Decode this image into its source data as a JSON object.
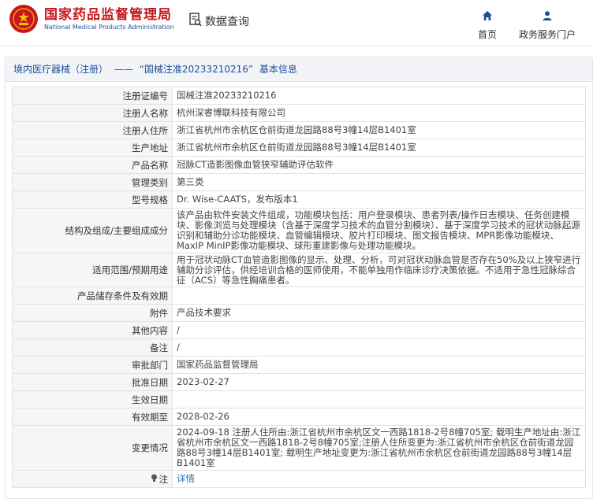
{
  "header": {
    "brand_cn": "国家药品监督管理局",
    "brand_en": "National Medical Products Administration",
    "search_label": "数据查询",
    "nav": [
      {
        "label": "首页",
        "icon": "home-icon"
      },
      {
        "label": "政务服务门户",
        "icon": "user-icon"
      }
    ]
  },
  "breadcrumb": {
    "category": "境内医疗器械（注册）",
    "sep": "——",
    "record": "“国械注准20233210216”",
    "suffix": "基本信息"
  },
  "rows": [
    {
      "key": "注册证编号",
      "value": "国械注准20233210216"
    },
    {
      "key": "注册人名称",
      "value": "杭州深睿博联科技有限公司"
    },
    {
      "key": "注册人住所",
      "value": "浙江省杭州市余杭区仓前街道龙园路88号3幢14层B1401室"
    },
    {
      "key": "生产地址",
      "value": "浙江省杭州市余杭区仓前街道龙园路88号3幢14层B1401室"
    },
    {
      "key": "产品名称",
      "value": "冠脉CT造影图像血管狭窄辅助评估软件"
    },
    {
      "key": "管理类别",
      "value": "第三类"
    },
    {
      "key": "型号规格",
      "value": "Dr. Wise-CAATS，发布版本1"
    },
    {
      "key": "结构及组成/主要组成成分",
      "value": "该产品由软件安装文件组成，功能模块包括：用户登录模块、患者列表/操作日志模块、任务创建模块、影像浏览与处理模块（含基于深度学习技术的血管分割模块）、基于深度学习技术的冠状动脉起源识别和辅助分诊功能模块、血管编辑模块、胶片打印模块、图文报告模块、MPR影像功能模块、MaxIP MinIP影像功能模块、球形重建影像与处理功能模块。"
    },
    {
      "key": "适用范围/预期用途",
      "value": "用于冠状动脉CT血管造影图像的显示、处理、分析，可对冠状动脉血管是否存在50%及以上狭窄进行辅助分诊评估，供经培训合格的医师使用，不能单独用作临床诊疗决策依据。不适用于急性冠脉综合征（ACS）等急性胸痛患者。"
    },
    {
      "key": "产品储存条件及有效期",
      "value": ""
    },
    {
      "key": "附件",
      "value": "产品技术要求"
    },
    {
      "key": "其他内容",
      "value": "/"
    },
    {
      "key": "备注",
      "value": "/"
    },
    {
      "key": "审批部门",
      "value": "国家药品监督管理局"
    },
    {
      "key": "批准日期",
      "value": "2023-02-27"
    },
    {
      "key": "生效日期",
      "value": ""
    },
    {
      "key": "有效期至",
      "value": "2028-02-26"
    },
    {
      "key": "变更情况",
      "value": "2024-09-18 注册人住所由:浙江省杭州市余杭区文一西路1818-2号8幢705室; 载明生产地址由:浙江省杭州市余杭区文一西路1818-2号8幢705室;注册人住所变更为:浙江省杭州市余杭区仓前街道龙园路88号3幢14层B1401室; 载明生产地址变更为:浙江省杭州市余杭区仓前街道龙园路88号3幢14层B1401室"
    },
    {
      "key": "注",
      "value": "详情",
      "icon": "bulb-icon"
    }
  ]
}
